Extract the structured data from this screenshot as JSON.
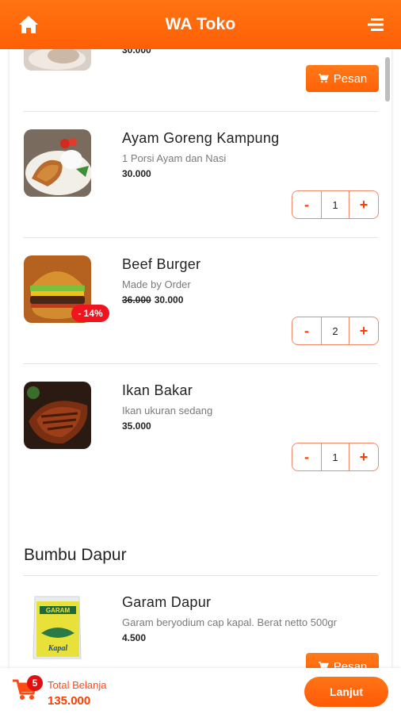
{
  "header": {
    "title": "WA Toko",
    "home_icon": "home-icon",
    "menu_icon": "menu-icon"
  },
  "colors": {
    "brand": "#ff6a0a",
    "discount": "#f0141e",
    "accent_text": "#ff3c00"
  },
  "top_partial_item": {
    "price": "30.000",
    "order_label": "Pesan"
  },
  "items": [
    {
      "name": "Ayam Goreng Kampung",
      "desc": "1 Porsi Ayam dan Nasi",
      "price": "30.000",
      "qty": "1",
      "minus": "-",
      "plus": "+"
    },
    {
      "name": "Beef Burger",
      "desc": "Made by Order",
      "old_price": "36.000",
      "price": "30.000",
      "qty": "2",
      "discount": "- 14%",
      "minus": "-",
      "plus": "+"
    },
    {
      "name": "Ikan Bakar",
      "desc": "Ikan ukuran sedang",
      "price": "35.000",
      "qty": "1",
      "minus": "-",
      "plus": "+"
    }
  ],
  "section2": {
    "title": "Bumbu Dapur",
    "item": {
      "name": "Garam Dapur",
      "desc": "Garam beryodium cap kapal. Berat netto 500gr",
      "price": "4.500",
      "order_label": "Pesan",
      "package_text": "GARAM",
      "package_brand": "Kapal"
    }
  },
  "footer": {
    "cart_count": "5",
    "total_label": "Total Belanja",
    "total_value": "135.000",
    "next_label": "Lanjut"
  }
}
